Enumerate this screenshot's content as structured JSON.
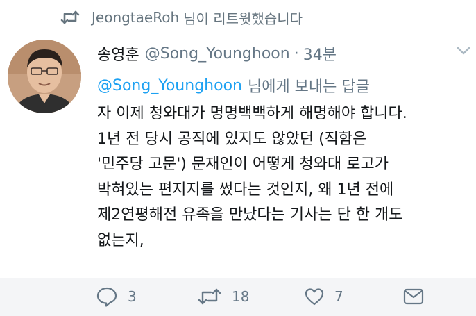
{
  "retweet_banner": {
    "icon": "retweet-icon",
    "user": "JeongtaeRoh",
    "text": "님이 리트윗했습니다"
  },
  "tweet": {
    "display_name": "송영훈",
    "handle": "@Song_Younghoon",
    "separator": "·",
    "time": "34분",
    "reply_mention": "@Song_Younghoon",
    "reply_text": "님에게 보내는 답글",
    "body_lines": [
      "자 이제 청와대가 명명백백하게 해명해야 합니다.",
      "1년 전 당시 공직에 있지도 않았던 (직함은",
      "'민주당 고문') 문재인이 어떻게 청와대 로고가",
      "박혀있는 편지지를 썼다는 것인지, 왜 1년 전에",
      "제2연평해전 유족을 만났다는 기사는 단 한 개도",
      "없는지,"
    ]
  },
  "actions": {
    "reply_count": "3",
    "retweet_count": "18",
    "like_count": "7"
  },
  "colors": {
    "link": "#1da1f2",
    "secondary_text": "#657786",
    "primary_text": "#14171a",
    "action_bar_bg": "#f4f5f7"
  }
}
